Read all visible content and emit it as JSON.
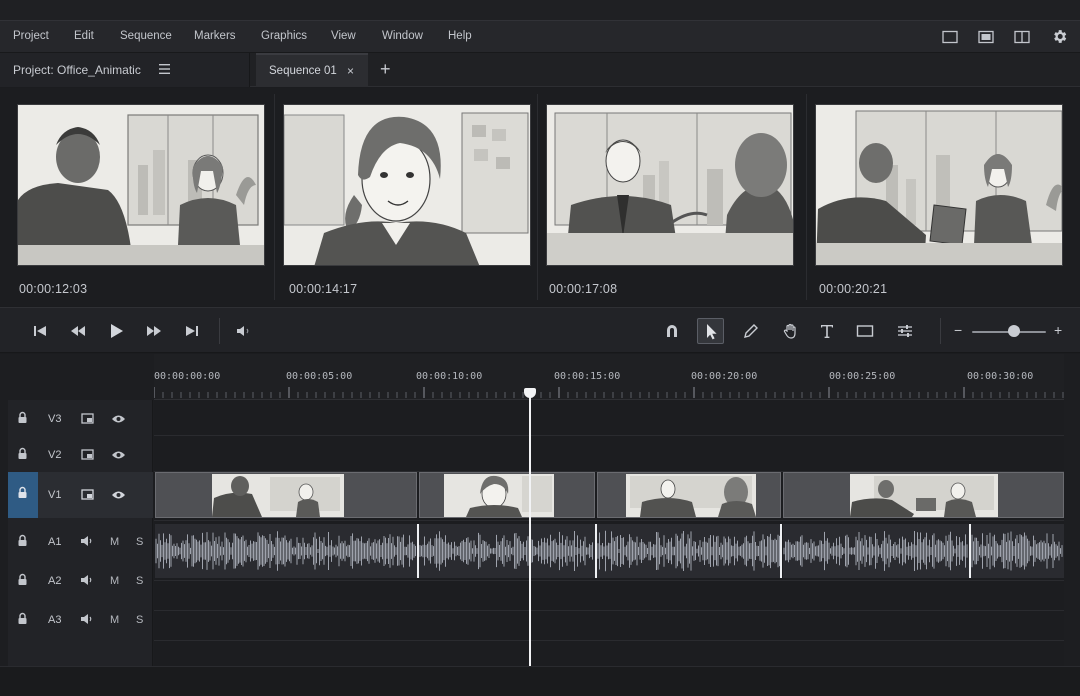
{
  "menu": [
    "Project",
    "Edit",
    "Sequence",
    "Markers",
    "Graphics",
    "View",
    "Window",
    "Help"
  ],
  "project": {
    "title": "Project: Office_Animatic"
  },
  "sequence_tab": {
    "title": "Sequence 01",
    "close": "×"
  },
  "add_tab": "+",
  "storyboard": {
    "frames": [
      {
        "timecode": "00:00:12:03"
      },
      {
        "timecode": "00:00:14:17"
      },
      {
        "timecode": "00:00:17:08"
      },
      {
        "timecode": "00:00:20:21"
      }
    ]
  },
  "zoom": {
    "minus": "−",
    "plus": "+",
    "level": 0.58
  },
  "ruler": [
    "00:00:00:00",
    "00:00:05:00",
    "00:00:10:00",
    "00:00:15:00",
    "00:00:20:00",
    "00:00:25:00",
    "00:00:30:00"
  ],
  "tracks": {
    "video": [
      "V3",
      "V2",
      "V1"
    ],
    "audio": [
      "A1",
      "A2",
      "A3"
    ],
    "mute": "M",
    "solo": "S"
  },
  "colors": {
    "accent": "#2f5b84",
    "playhead": "#f2f3f5",
    "waveform": "#9fa3ad"
  }
}
